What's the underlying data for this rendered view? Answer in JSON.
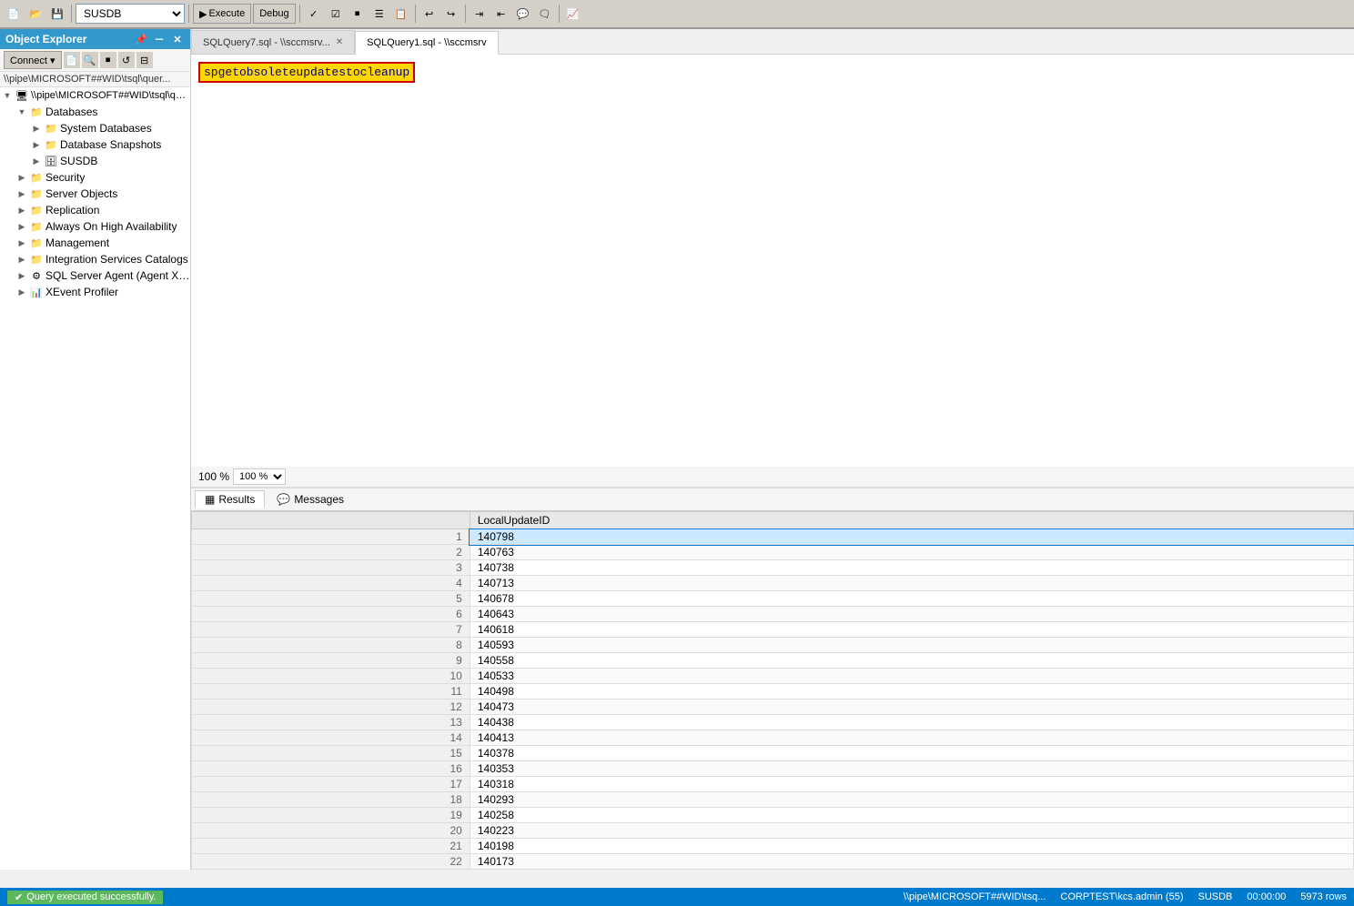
{
  "app": {
    "db_selector": "SUSDB",
    "execute_label": "Execute",
    "debug_label": "Debug"
  },
  "object_explorer": {
    "title": "Object Explorer",
    "path": "\\\\pipe\\MICROSOFT##WID\\tsql\\quer...",
    "connect_label": "Connect ▾",
    "tree": [
      {
        "id": "root",
        "label": "\\\\pipe\\MICROSOFT##WID\\tsql\\quer...",
        "level": 0,
        "expanded": true,
        "icon": "🖥"
      },
      {
        "id": "databases",
        "label": "Databases",
        "level": 1,
        "expanded": true,
        "icon": "📁"
      },
      {
        "id": "system-dbs",
        "label": "System Databases",
        "level": 2,
        "expanded": false,
        "icon": "📁"
      },
      {
        "id": "db-snapshots",
        "label": "Database Snapshots",
        "level": 2,
        "expanded": false,
        "icon": "📁"
      },
      {
        "id": "susdb",
        "label": "SUSDB",
        "level": 2,
        "expanded": false,
        "icon": "🗄"
      },
      {
        "id": "security",
        "label": "Security",
        "level": 1,
        "expanded": false,
        "icon": "📁"
      },
      {
        "id": "server-objects",
        "label": "Server Objects",
        "level": 1,
        "expanded": false,
        "icon": "📁"
      },
      {
        "id": "replication",
        "label": "Replication",
        "level": 1,
        "expanded": false,
        "icon": "📁"
      },
      {
        "id": "always-on",
        "label": "Always On High Availability",
        "level": 1,
        "expanded": false,
        "icon": "📁"
      },
      {
        "id": "management",
        "label": "Management",
        "level": 1,
        "expanded": false,
        "icon": "📁"
      },
      {
        "id": "integration",
        "label": "Integration Services Catalogs",
        "level": 1,
        "expanded": false,
        "icon": "📁"
      },
      {
        "id": "sql-agent",
        "label": "SQL Server Agent (Agent XPs disabl...",
        "level": 1,
        "expanded": false,
        "icon": "⚙"
      },
      {
        "id": "xevent",
        "label": "XEvent Profiler",
        "level": 1,
        "expanded": false,
        "icon": "📊"
      }
    ]
  },
  "tabs": [
    {
      "id": "tab1",
      "label": "SQLQuery7.sql - \\\\sccmsrv...",
      "active": false,
      "closable": true
    },
    {
      "id": "tab2",
      "label": "SQLQuery1.sql - \\\\sccmsrv",
      "active": true,
      "closable": false
    }
  ],
  "query": {
    "text": "spgetobsoleteupdatestocleanup",
    "highlighted": true
  },
  "zoom": {
    "level": "100 %"
  },
  "results": {
    "tabs": [
      {
        "id": "results",
        "label": "Results",
        "active": true,
        "icon": "grid"
      },
      {
        "id": "messages",
        "label": "Messages",
        "active": false,
        "icon": "msg"
      }
    ],
    "column": "LocalUpdateID",
    "rows": [
      {
        "num": 1,
        "value": "140798",
        "selected": true
      },
      {
        "num": 2,
        "value": "140763"
      },
      {
        "num": 3,
        "value": "140738"
      },
      {
        "num": 4,
        "value": "140713"
      },
      {
        "num": 5,
        "value": "140678"
      },
      {
        "num": 6,
        "value": "140643"
      },
      {
        "num": 7,
        "value": "140618"
      },
      {
        "num": 8,
        "value": "140593"
      },
      {
        "num": 9,
        "value": "140558"
      },
      {
        "num": 10,
        "value": "140533"
      },
      {
        "num": 11,
        "value": "140498"
      },
      {
        "num": 12,
        "value": "140473"
      },
      {
        "num": 13,
        "value": "140438"
      },
      {
        "num": 14,
        "value": "140413"
      },
      {
        "num": 15,
        "value": "140378"
      },
      {
        "num": 16,
        "value": "140353"
      },
      {
        "num": 17,
        "value": "140318"
      },
      {
        "num": 18,
        "value": "140293"
      },
      {
        "num": 19,
        "value": "140258"
      },
      {
        "num": 20,
        "value": "140223"
      },
      {
        "num": 21,
        "value": "140198"
      },
      {
        "num": 22,
        "value": "140173"
      }
    ]
  },
  "status": {
    "message": "Query executed successfully.",
    "connection": "\\\\pipe\\MICROSOFT##WID\\tsq...",
    "user": "CORPTEST\\kcs.admin (55)",
    "database": "SUSDB",
    "time": "00:00:00",
    "rows": "5973 rows"
  }
}
